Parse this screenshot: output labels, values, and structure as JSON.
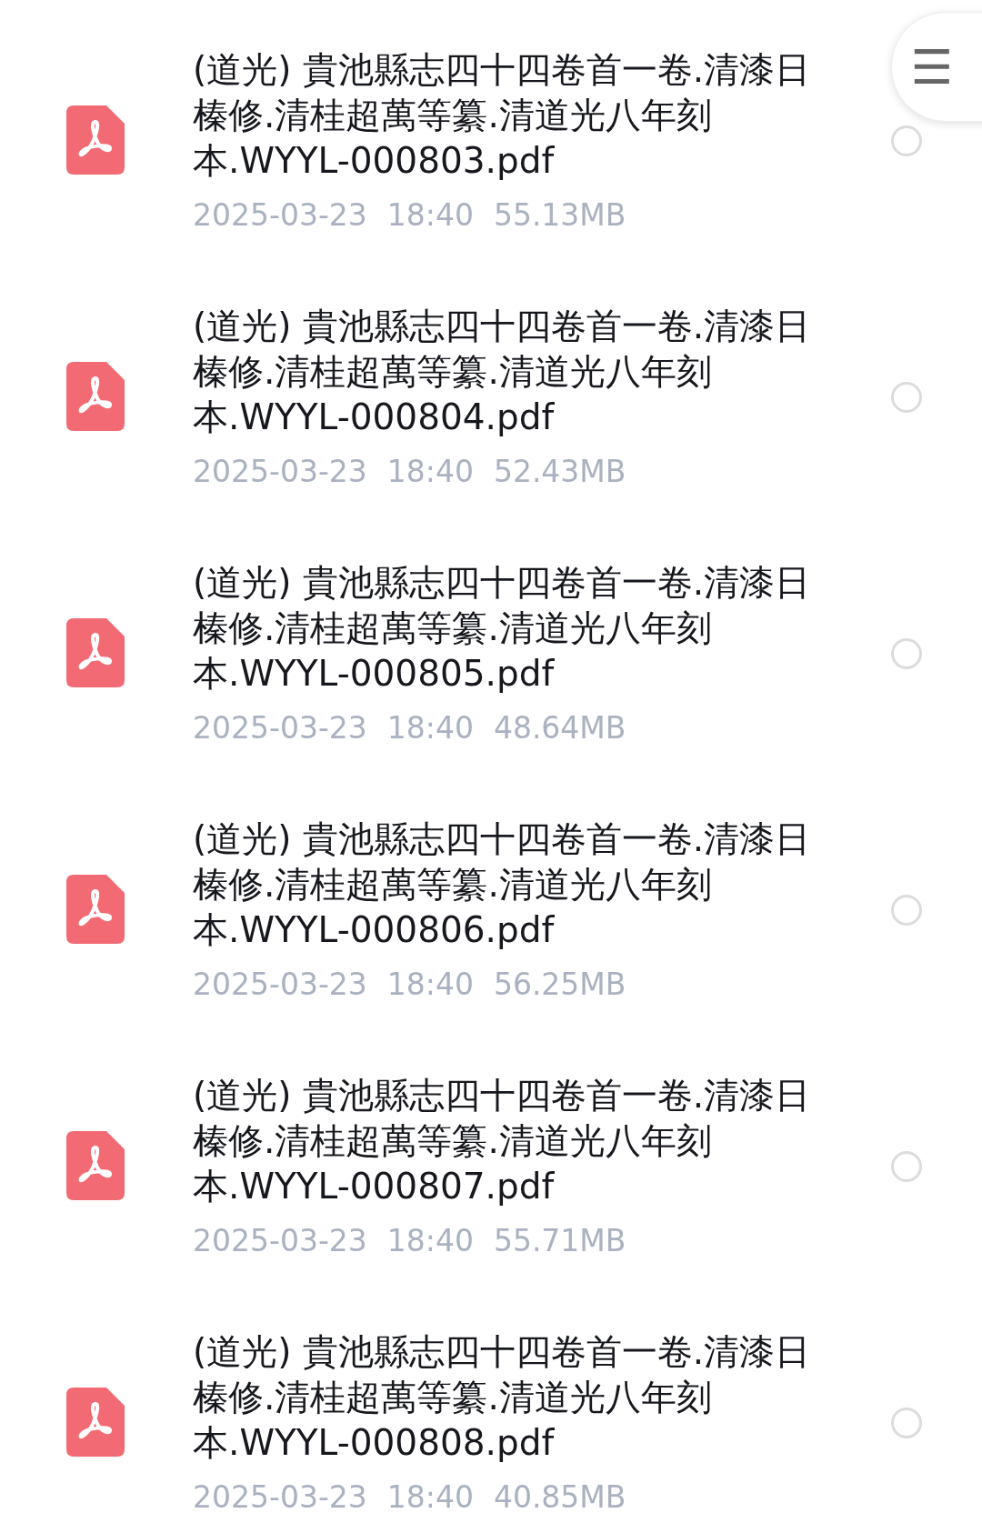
{
  "menu_button": {
    "label": "☰"
  },
  "files": [
    {
      "name": "(道光) 貴池縣志四十四卷首一卷.清漆日榛修.清桂超萬等纂.清道光八年刻本.WYYL-000803.pdf",
      "date": "2025-03-23",
      "time": "18:40",
      "size": "55.13MB",
      "selected": false
    },
    {
      "name": "(道光) 貴池縣志四十四卷首一卷.清漆日榛修.清桂超萬等纂.清道光八年刻本.WYYL-000804.pdf",
      "date": "2025-03-23",
      "time": "18:40",
      "size": "52.43MB",
      "selected": false
    },
    {
      "name": "(道光) 貴池縣志四十四卷首一卷.清漆日榛修.清桂超萬等纂.清道光八年刻本.WYYL-000805.pdf",
      "date": "2025-03-23",
      "time": "18:40",
      "size": "48.64MB",
      "selected": false
    },
    {
      "name": "(道光) 貴池縣志四十四卷首一卷.清漆日榛修.清桂超萬等纂.清道光八年刻本.WYYL-000806.pdf",
      "date": "2025-03-23",
      "time": "18:40",
      "size": "56.25MB",
      "selected": false
    },
    {
      "name": "(道光) 貴池縣志四十四卷首一卷.清漆日榛修.清桂超萬等纂.清道光八年刻本.WYYL-000807.pdf",
      "date": "2025-03-23",
      "time": "18:40",
      "size": "55.71MB",
      "selected": false
    },
    {
      "name": "(道光) 貴池縣志四十四卷首一卷.清漆日榛修.清桂超萬等纂.清道光八年刻本.WYYL-000808.pdf",
      "date": "2025-03-23",
      "time": "18:40",
      "size": "40.85MB",
      "selected": false
    }
  ]
}
